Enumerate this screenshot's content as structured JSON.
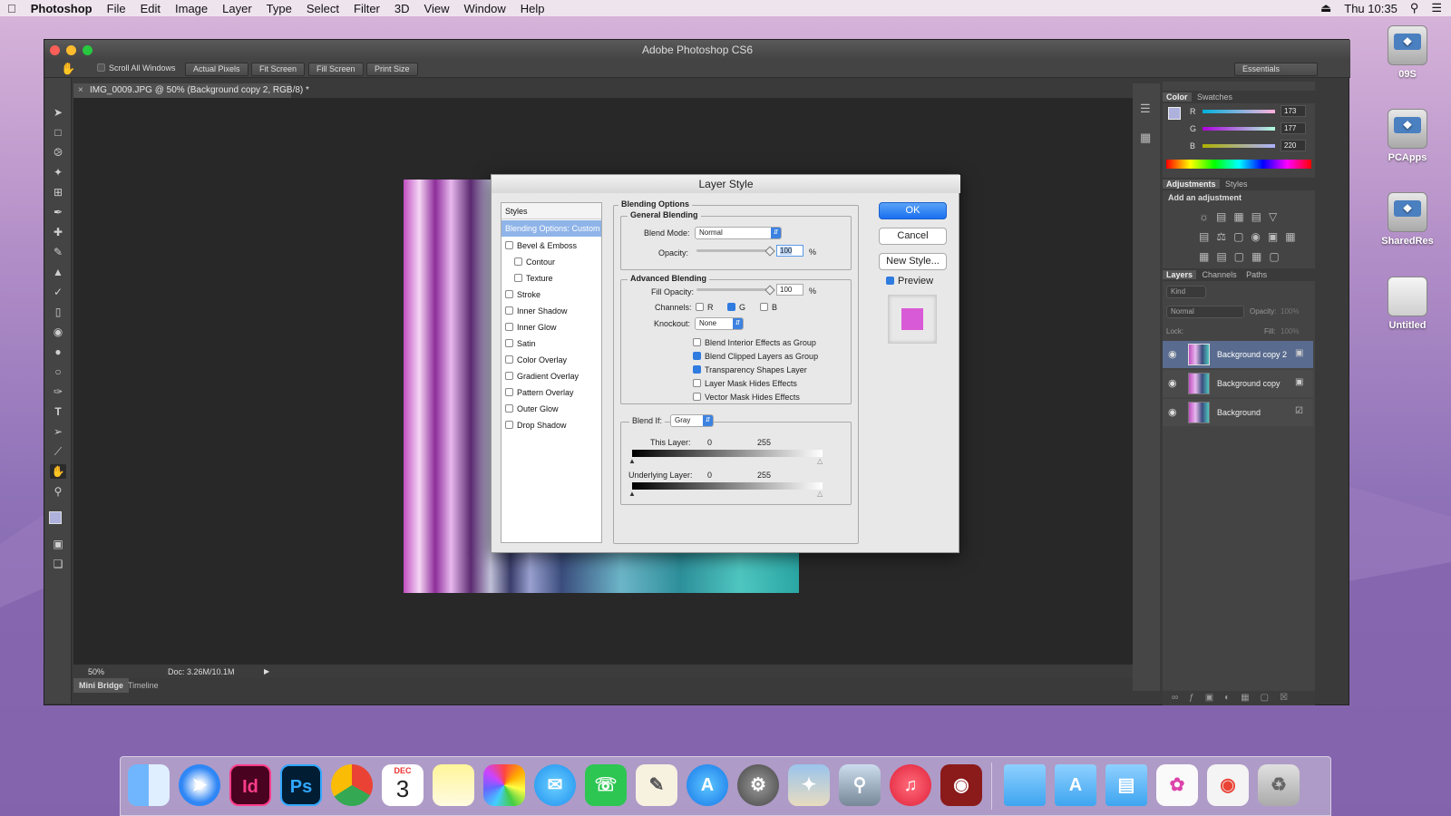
{
  "menubar": {
    "app": "Photoshop",
    "items": [
      "File",
      "Edit",
      "Image",
      "Layer",
      "Type",
      "Select",
      "Filter",
      "3D",
      "View",
      "Window",
      "Help"
    ],
    "clock": "Thu 10:35"
  },
  "window": {
    "title": "Adobe Photoshop CS6",
    "options": {
      "scroll_all": "Scroll All Windows",
      "actual_pixels": "Actual Pixels",
      "fit_screen": "Fit Screen",
      "fill_screen": "Fill Screen",
      "print_size": "Print Size",
      "workspace": "Essentials"
    },
    "doc_tab": "IMG_0009.JPG @ 50% (Background copy 2, RGB/8) *",
    "status": {
      "zoom": "50%",
      "doc": "Doc: 3.26M/10.1M"
    },
    "bottom_tabs": [
      "Mini Bridge",
      "Timeline"
    ]
  },
  "panels": {
    "color": {
      "tabs": [
        "Color",
        "Swatches"
      ],
      "r": "173",
      "g": "177",
      "b": "220",
      "r_label": "R",
      "g_label": "G",
      "b_label": "B"
    },
    "adjustments": {
      "tabs": [
        "Adjustments",
        "Styles"
      ],
      "hint": "Add an adjustment"
    },
    "layers": {
      "tabs": [
        "Layers",
        "Channels",
        "Paths"
      ],
      "kind": "Kind",
      "blend": "Normal",
      "opacity_label": "Opacity:",
      "opacity_value": "100%",
      "lock_label": "Lock:",
      "fill_label": "Fill:",
      "fill_value": "100%",
      "items": [
        "Background copy 2",
        "Background copy",
        "Background"
      ]
    }
  },
  "dialog": {
    "title": "Layer Style",
    "styles_header": "Styles",
    "style_items": [
      "Blending Options: Custom",
      "Bevel & Emboss",
      "Contour",
      "Texture",
      "Stroke",
      "Inner Shadow",
      "Inner Glow",
      "Satin",
      "Color Overlay",
      "Gradient Overlay",
      "Pattern Overlay",
      "Outer Glow",
      "Drop Shadow"
    ],
    "blending_options": "Blending Options",
    "general_blending": "General Blending",
    "blend_mode_label": "Blend Mode:",
    "blend_mode": "Normal",
    "opacity_label": "Opacity:",
    "opacity": "100",
    "pct": "%",
    "advanced_blending": "Advanced Blending",
    "fill_opacity_label": "Fill Opacity:",
    "fill_opacity": "100",
    "channels_label": "Channels:",
    "ch_r": "R",
    "ch_g": "G",
    "ch_b": "B",
    "knockout_label": "Knockout:",
    "knockout": "None",
    "adv_options": [
      "Blend Interior Effects as Group",
      "Blend Clipped Layers as Group",
      "Transparency Shapes Layer",
      "Layer Mask Hides Effects",
      "Vector Mask Hides Effects"
    ],
    "blend_if_label": "Blend If:",
    "blend_if": "Gray",
    "this_layer": "This Layer:",
    "underlying_layer": "Underlying Layer:",
    "min": "0",
    "max": "255",
    "ok": "OK",
    "cancel": "Cancel",
    "new_style": "New Style...",
    "preview": "Preview",
    "preview_color": "#d95ad6"
  },
  "desktop_icons": [
    "09S",
    "PCApps",
    "SharedRes",
    "Untitled"
  ],
  "dock_calendar": {
    "month": "DEC",
    "day": "3"
  },
  "dock_text_icons": {
    "indesign": "Id",
    "photoshop": "Ps"
  }
}
